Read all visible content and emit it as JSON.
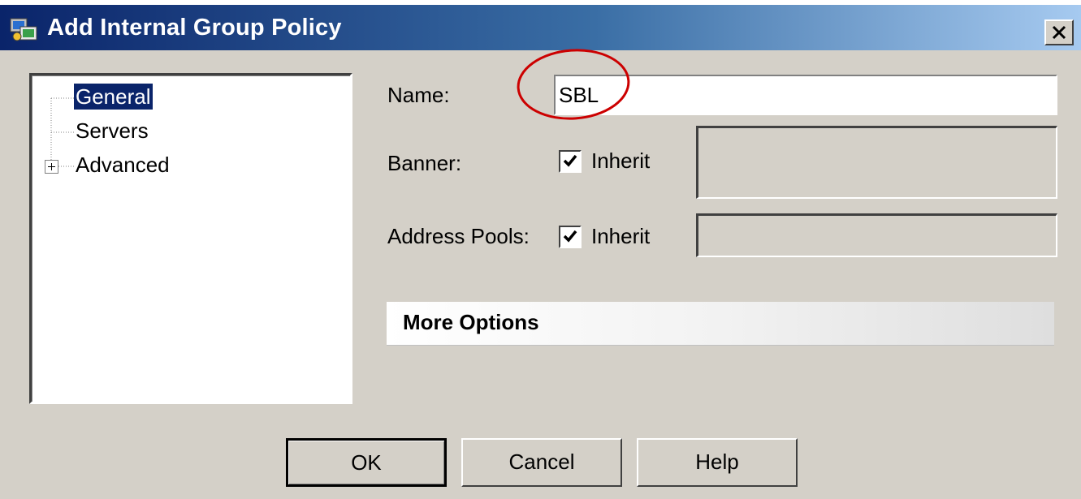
{
  "window": {
    "title": "Add Internal Group Policy"
  },
  "tree": {
    "items": [
      {
        "label": "General",
        "selected": true
      },
      {
        "label": "Servers",
        "selected": false
      },
      {
        "label": "Advanced",
        "selected": false,
        "expandable": true
      }
    ]
  },
  "form": {
    "name_label": "Name:",
    "name_value": "SBL",
    "banner_label": "Banner:",
    "banner_inherit_label": "Inherit",
    "banner_inherit_checked": true,
    "pools_label": "Address Pools:",
    "pools_inherit_label": "Inherit",
    "pools_inherit_checked": true
  },
  "more_options": {
    "label": "More Options"
  },
  "buttons": {
    "ok": "OK",
    "cancel": "Cancel",
    "help": "Help"
  },
  "annotation": {
    "highlight_color": "#cc0000"
  },
  "icons": [
    "app-icon",
    "close-icon",
    "tree-expand-icon",
    "checkmark-icon"
  ]
}
